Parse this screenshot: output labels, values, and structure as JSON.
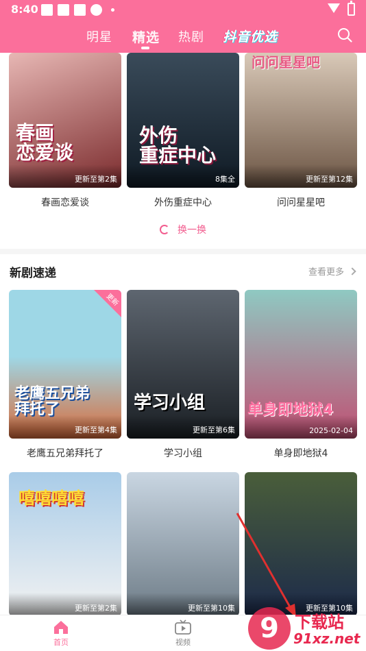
{
  "status_bar": {
    "time": "8:40"
  },
  "nav": {
    "tabs": [
      "明星",
      "精选",
      "热剧"
    ],
    "active_tab": "精选",
    "brand": "抖音优选"
  },
  "top_row": [
    {
      "name": "春画恋爱谈",
      "art_text": "春画\n恋爱谈",
      "badge": "更新至第2集",
      "color_a": "#e7b7b4",
      "color_b": "#7a2a2c"
    },
    {
      "name": "外伤重症中心",
      "art_text": "外伤\n重症中心",
      "badge": "8集全",
      "color_a": "#3a4b5a",
      "color_b": "#0f1a24"
    },
    {
      "name": "问问星星吧",
      "art_text": "问问星星吧",
      "badge": "更新至第12集",
      "color_a": "#d9c9b8",
      "color_b": "#6b5443"
    }
  ],
  "refresh": {
    "label": "换一换"
  },
  "section": {
    "title": "新剧速递",
    "more": "查看更多"
  },
  "grid_row1": [
    {
      "name": "老鹰五兄弟拜托了",
      "art_text": "老鹰五兄弟\n拜托了",
      "badge": "更新至第4集",
      "corner": "更新",
      "color_a": "#9ed7e6",
      "color_b": "#d96b3a"
    },
    {
      "name": "学习小组",
      "art_text": "学习小组",
      "badge": "更新至第6集",
      "color_a": "#5e6670",
      "color_b": "#1a1f24"
    },
    {
      "name": "单身即地狱4",
      "art_text": "单身即地狱4",
      "badge": "2025-02-04",
      "color_a": "#8fc9c2",
      "color_b": "#c04f72"
    }
  ],
  "grid_row2": [
    {
      "art_text": "嘻嘻嘻嘻",
      "badge": "更新至第2集",
      "color_a": "#a9cce8",
      "color_b": "#f2f2f2"
    },
    {
      "art_text": "",
      "badge": "更新至第10集",
      "color_a": "#c9d6e2",
      "color_b": "#6d7b86"
    },
    {
      "art_text": "",
      "badge": "更新至第10集",
      "color_a": "#4a5e3a",
      "color_b": "#1c2a4a"
    }
  ],
  "tabbar": [
    {
      "label": "首页",
      "icon": "home-icon"
    },
    {
      "label": "视频",
      "icon": "tv-icon"
    }
  ],
  "watermark": {
    "line1": "下载站",
    "line2": "91xz.net",
    "glyph": "9"
  },
  "colors": {
    "accent": "#fb6f9b",
    "refresh": "#f25c8e"
  }
}
